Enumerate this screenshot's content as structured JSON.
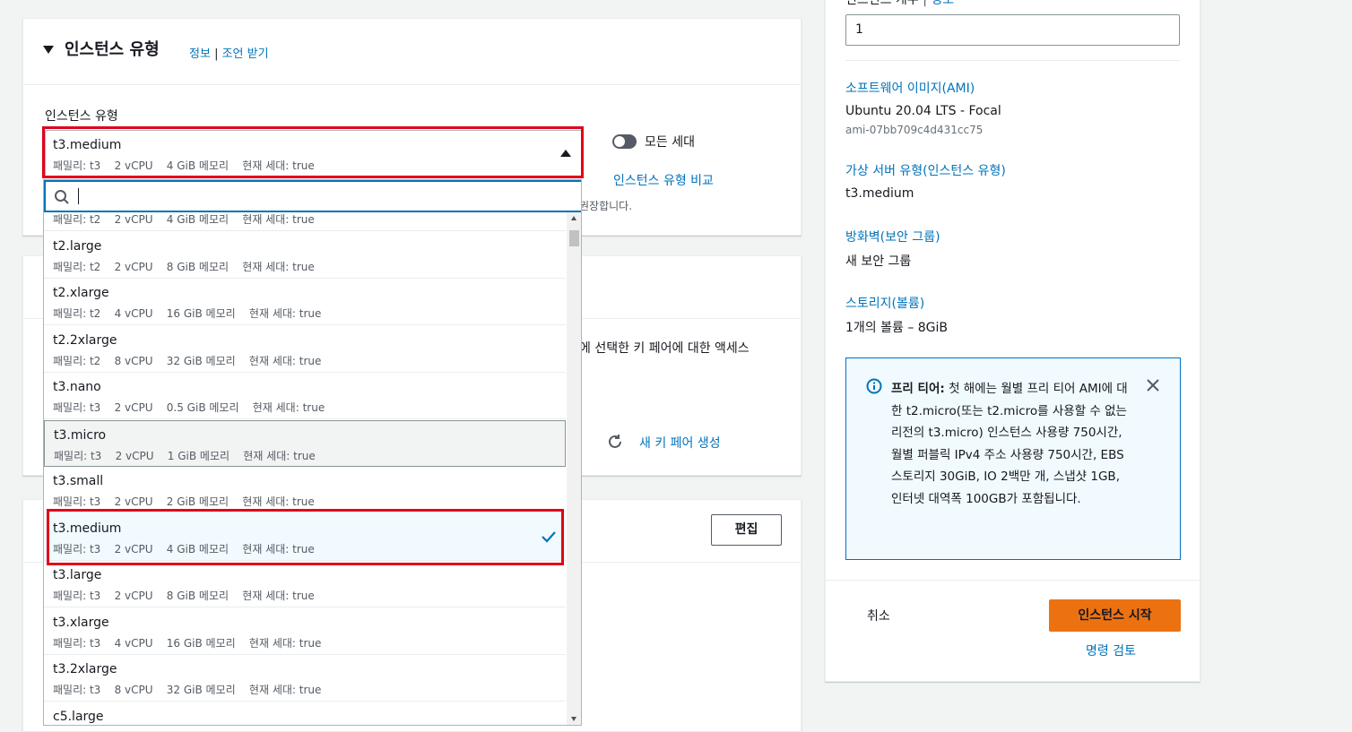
{
  "instance_type_section": {
    "title": "인스턴스 유형",
    "info_link": "정보",
    "separator": "|",
    "advice_link": "조언 받기",
    "field_label": "인스턴스 유형",
    "selected": {
      "name": "t3.medium",
      "details": "패밀리: t3    2 vCPU    4 GiB 메모리    현재 세대: true"
    },
    "toggle_label": "모든 세대",
    "compare_link": "인스턴스 유형 비교",
    "hint_text": "권장합니다."
  },
  "dropdown": {
    "search_value": "",
    "options": [
      {
        "name": "",
        "details": "패밀리: t2    2 vCPU    4 GiB 메모리    현재 세대: true",
        "state": "partial"
      },
      {
        "name": "t2.large",
        "details": "패밀리: t2    2 vCPU    8 GiB 메모리    현재 세대: true",
        "state": "normal"
      },
      {
        "name": "t2.xlarge",
        "details": "패밀리: t2    4 vCPU    16 GiB 메모리    현재 세대: true",
        "state": "normal"
      },
      {
        "name": "t2.2xlarge",
        "details": "패밀리: t2    8 vCPU    32 GiB 메모리    현재 세대: true",
        "state": "normal"
      },
      {
        "name": "t3.nano",
        "details": "패밀리: t3    2 vCPU    0.5 GiB 메모리    현재 세대: true",
        "state": "normal"
      },
      {
        "name": "t3.micro",
        "details": "패밀리: t3    2 vCPU    1 GiB 메모리    현재 세대: true",
        "state": "hover"
      },
      {
        "name": "t3.small",
        "details": "패밀리: t3    2 vCPU    2 GiB 메모리    현재 세대: true",
        "state": "normal"
      },
      {
        "name": "t3.medium",
        "details": "패밀리: t3    2 vCPU    4 GiB 메모리    현재 세대: true",
        "state": "selected"
      },
      {
        "name": "t3.large",
        "details": "패밀리: t3    2 vCPU    8 GiB 메모리    현재 세대: true",
        "state": "normal"
      },
      {
        "name": "t3.xlarge",
        "details": "패밀리: t3    4 vCPU    16 GiB 메모리    현재 세대: true",
        "state": "normal"
      },
      {
        "name": "t3.2xlarge",
        "details": "패밀리: t3    8 vCPU    32 GiB 메모리    현재 세대: true",
        "state": "normal"
      },
      {
        "name": "c5.large",
        "details": "",
        "state": "normal"
      }
    ]
  },
  "keypair_section": {
    "text": "에 선택한 키 페어에 대한 액세스",
    "new_keypair_link": "새 키 페어 생성"
  },
  "network_section": {
    "edit_button": "편집"
  },
  "summary": {
    "count_label": "인스턴스 개수",
    "count_separator": "|",
    "count_info_link": "정보",
    "count_value": "1",
    "ami_heading": "소프트웨어 이미지(AMI)",
    "ami_name": "Ubuntu 20.04 LTS - Focal",
    "ami_id": "ami-07bb709c4d431cc75",
    "server_type_heading": "가상 서버 유형(인스턴스 유형)",
    "server_type_value": "t3.medium",
    "firewall_heading": "방화벽(보안 그룹)",
    "firewall_value": "새 보안 그룹",
    "storage_heading": "스토리지(볼륨)",
    "storage_value": "1개의 볼륨 – 8GiB",
    "free_tier_title": "프리 티어:",
    "free_tier_body": " 첫 해에는 월별 프리 티어 AMI에 대한 t2.micro(또는 t2.micro를 사용할 수 없는 리전의 t3.micro) 인스턴스 사용량 750시간, 월별 퍼블릭 IPv4 주소 사용량 750시간, EBS 스토리지 30GiB, IO 2백만 개, 스냅샷 1GB, 인터넷 대역폭 100GB가 포함됩니다.",
    "cancel_label": "취소",
    "launch_button": "인스턴스 시작",
    "review_link": "명령 검토"
  },
  "colors": {
    "link": "#0073bb",
    "primary_button": "#ec7211",
    "highlight_box": "#e0001b",
    "info_bg": "#f1faff"
  }
}
